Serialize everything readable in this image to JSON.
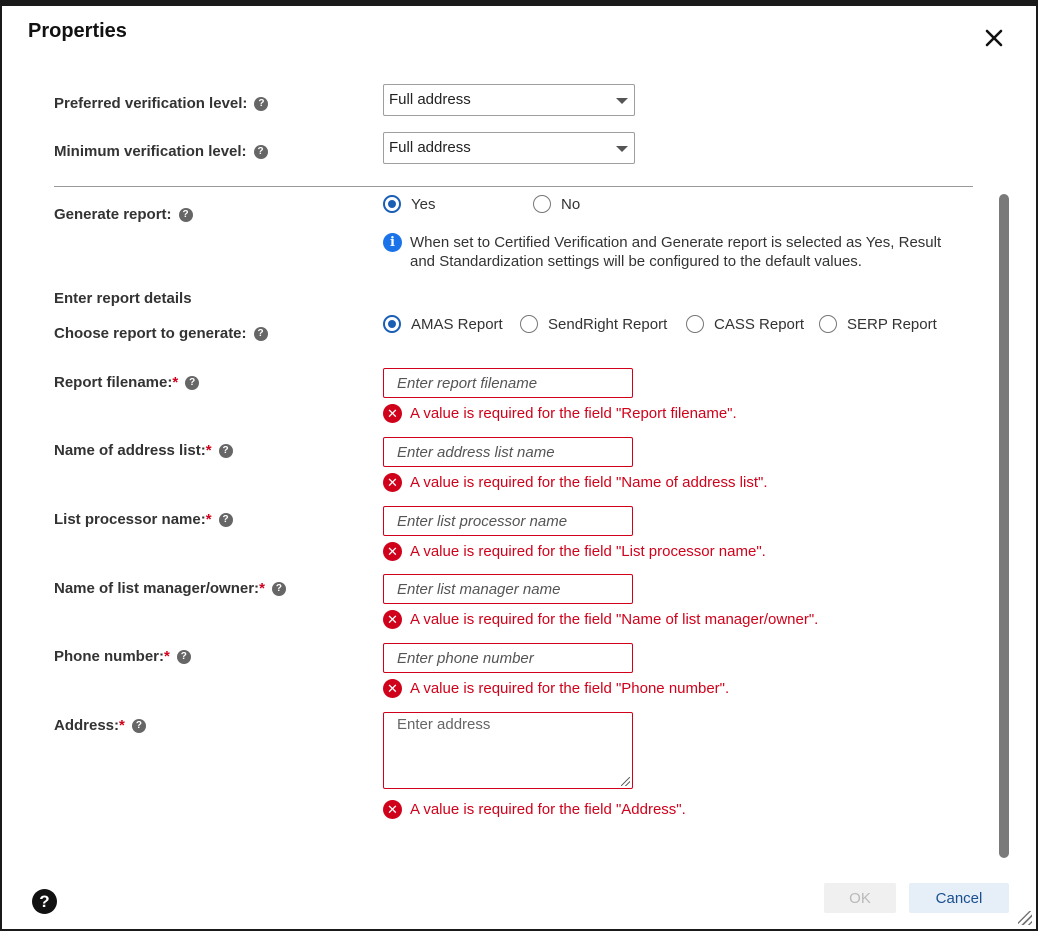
{
  "dialog": {
    "title": "Properties",
    "close_icon": "close-icon"
  },
  "verification": {
    "preferred_label": "Preferred verification level:",
    "preferred_value": "Full address",
    "minimum_label": "Minimum verification level:",
    "minimum_value": "Full address"
  },
  "generate_report": {
    "label": "Generate report:",
    "options": [
      "Yes",
      "No"
    ],
    "selected": "Yes",
    "info_text": "When set to Certified Verification and Generate report is selected as Yes, Result and Standardization settings will be configured to the default values."
  },
  "report_details": {
    "section_title": "Enter report details",
    "choose_label": "Choose report to generate:",
    "report_options": [
      "AMAS Report",
      "SendRight Report",
      "CASS Report",
      "SERP Report"
    ],
    "selected_report": "AMAS Report"
  },
  "fields": [
    {
      "label": "Report filename:",
      "required_mark": "*",
      "placeholder": "Enter report filename",
      "error": "A value is required for the field \"Report filename\"."
    },
    {
      "label": "Name of address list:",
      "required_mark": "*",
      "placeholder": "Enter address list name",
      "error": "A value is required for the field \"Name of address list\"."
    },
    {
      "label": "List processor name:",
      "required_mark": "*",
      "placeholder": "Enter list processor name",
      "error": "A value is required for the field \"List processor name\"."
    },
    {
      "label": "Name of list manager/owner:",
      "required_mark": "*",
      "placeholder": "Enter list manager name",
      "error": "A value is required for the field \"Name of list manager/owner\"."
    },
    {
      "label": "Phone number:",
      "required_mark": "*",
      "placeholder": "Enter phone number",
      "error": "A value is required for the field \"Phone number\"."
    },
    {
      "label": "Address:",
      "required_mark": "*",
      "placeholder": "Enter address",
      "error": "A value is required for the field \"Address\"."
    }
  ],
  "footer": {
    "ok_label": "OK",
    "cancel_label": "Cancel",
    "help_symbol": "?"
  },
  "icons": {
    "help": "?",
    "info": "i",
    "error": "✕"
  },
  "colors": {
    "accent": "#1a5fb4",
    "error": "#d0021b",
    "info": "#1a73e8"
  }
}
